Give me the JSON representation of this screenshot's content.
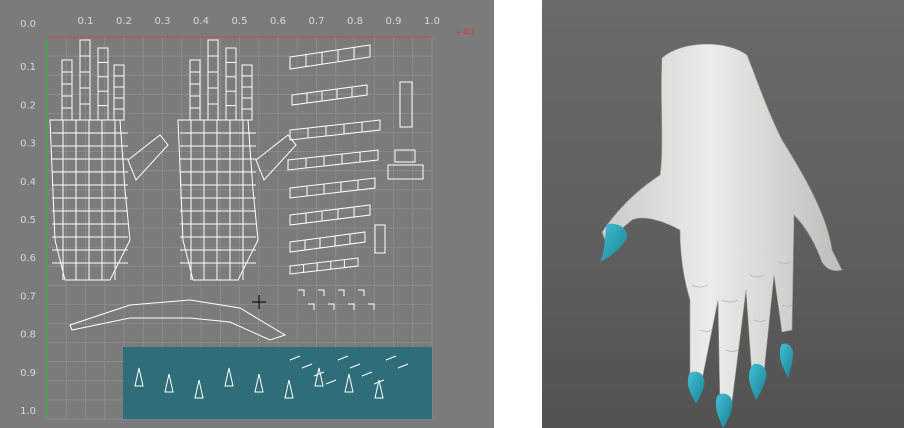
{
  "uv_editor": {
    "u_axis_labels": [
      "0.1",
      "0.2",
      "0.3",
      "0.4",
      "0.5",
      "0.6",
      "0.7",
      "0.8",
      "0.9",
      "1.0"
    ],
    "v_axis_labels": [
      "0.0",
      "0.1",
      "0.2",
      "0.3",
      "0.4",
      "0.5",
      "0.6",
      "0.7",
      "0.8",
      "0.9",
      "1.0"
    ],
    "corner_label": "+40",
    "colors": {
      "background": "#7b7b7b",
      "grid": "#8f8f8f",
      "wire": "#ffffff",
      "selection_region": "#2f6d78",
      "u_axis": "#c84a4a",
      "v_axis": "#3fa84a"
    }
  },
  "viewport_3d": {
    "object": "hand-model",
    "colors": {
      "skin": "#e2e2e0",
      "nails": "#2aa3b8"
    }
  }
}
